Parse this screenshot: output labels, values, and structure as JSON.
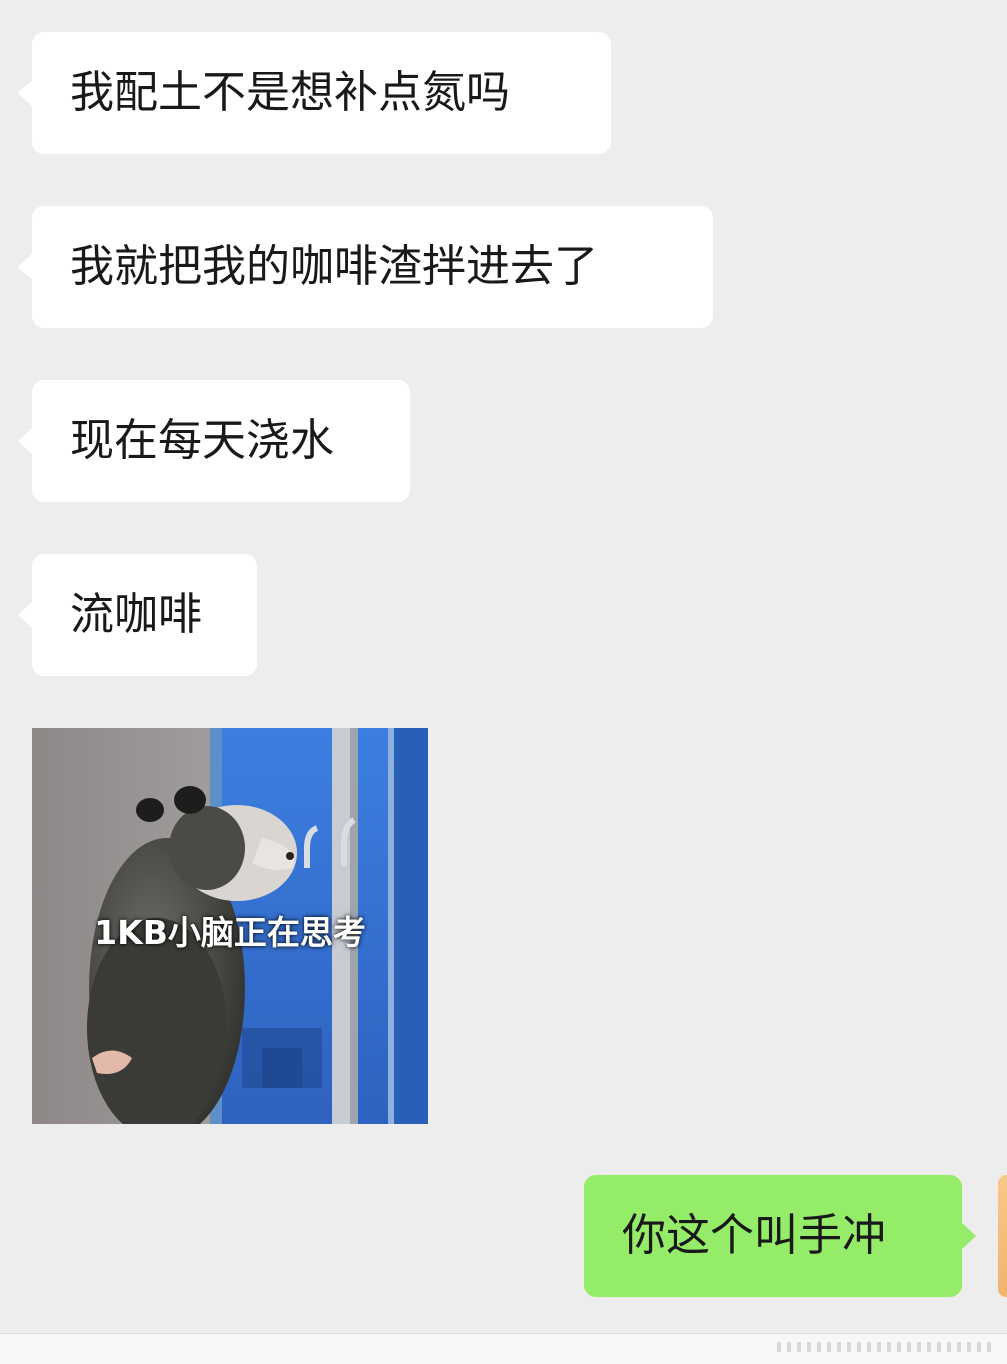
{
  "chat": {
    "messages": [
      {
        "sender": "other",
        "type": "text",
        "text": "我配土不是想补点氮吗"
      },
      {
        "sender": "other",
        "type": "text",
        "text": "我就把我的咖啡渣拌进去了"
      },
      {
        "sender": "other",
        "type": "text",
        "text": "现在每天浇水"
      },
      {
        "sender": "other",
        "type": "text",
        "text": "流咖啡"
      },
      {
        "sender": "other",
        "type": "sticker",
        "caption": "1KB小脑正在思考"
      },
      {
        "sender": "me",
        "type": "text",
        "text": "你这个叫手冲"
      }
    ]
  },
  "colors": {
    "background": "#ededed",
    "incoming_bubble": "#ffffff",
    "outgoing_bubble": "#95ec69",
    "text": "#191919"
  }
}
